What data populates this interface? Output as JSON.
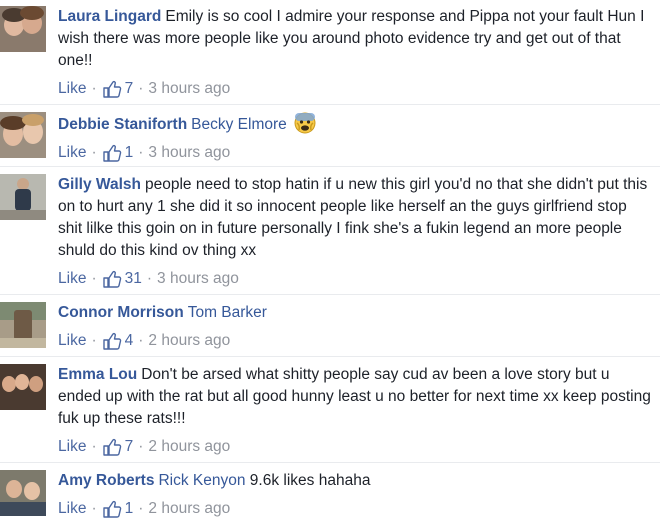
{
  "comments": [
    {
      "author": "Laura Lingard",
      "mention": "",
      "text": "Emily is so cool I admire your response and Pippa not your fault Hun I wish there was more people like you around photo evidence try and get out of that one!!",
      "like_label": "Like",
      "likes": "7",
      "time": "3 hours ago"
    },
    {
      "author": "Debbie Staniforth",
      "mention": "Becky Elmore",
      "text": "",
      "emoji": "fearful-face-icon",
      "like_label": "Like",
      "likes": "1",
      "time": "3 hours ago"
    },
    {
      "author": "Gilly Walsh",
      "mention": "",
      "text": "people need to stop hatin if u new this girl you'd no that she didn't put this on to hurt any 1 she did it so innocent people like herself an the guys girlfriend stop shit lilke this goin on in future personally I fink she's a fukin legend an more people shuld do this kind ov thing xx",
      "like_label": "Like",
      "likes": "31",
      "time": "3 hours ago"
    },
    {
      "author": "Connor Morrison",
      "mention": "Tom Barker",
      "text": "",
      "like_label": "Like",
      "likes": "4",
      "time": "2 hours ago"
    },
    {
      "author": "Emma Lou",
      "mention": "",
      "text": "Don't be arsed what shitty people say cud av been a love story but u ended up with the rat but all good hunny least u no better for next time xx keep posting fuk up these rats!!!",
      "like_label": "Like",
      "likes": "7",
      "time": "2 hours ago"
    },
    {
      "author": "Amy Roberts",
      "mention": "Rick Kenyon",
      "text": "9.6k likes hahaha",
      "like_label": "Like",
      "likes": "1",
      "time": "2 hours ago"
    }
  ],
  "colors": {
    "link": "#365899",
    "meta": "#90949c",
    "like_blue": "#4b67a1",
    "divider": "#e9ebee"
  }
}
